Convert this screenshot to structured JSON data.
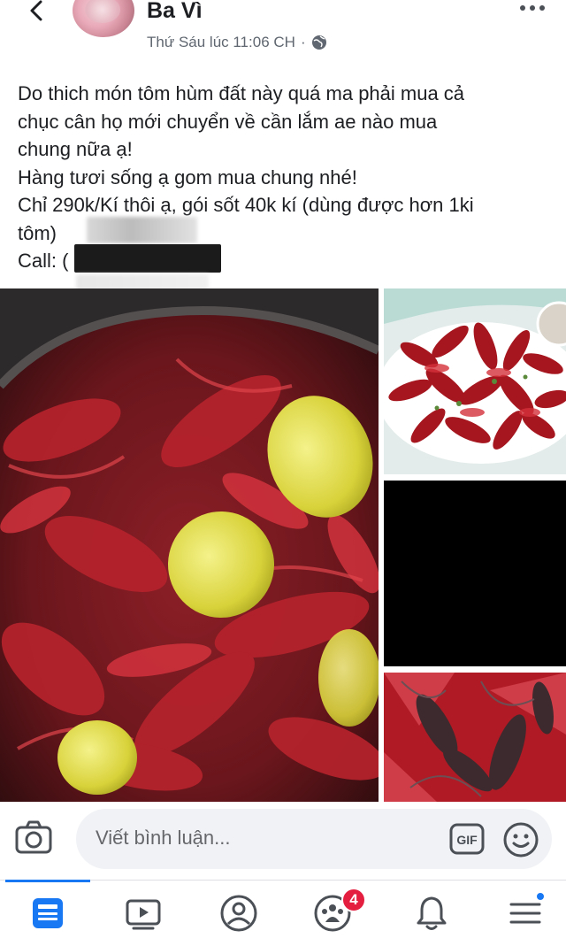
{
  "header": {
    "author_name": "Ba Vì",
    "timestamp": "Thứ Sáu lúc 11:06 CH",
    "separator": "·",
    "privacy_icon": "globe-icon",
    "back_icon": "chevron-left-icon",
    "more_icon": "more-dots-icon"
  },
  "post": {
    "lines": [
      "Do thich món tôm hùm đất này quá ma phải mua cả",
      "chục cân họ mới chuyển về cần lắm ae nào mua",
      "chung nữa ạ!",
      "Hàng tươi sống ạ gom mua chung nhé!",
      "Chỉ 290k/Kí thôi ạ, gói sốt 40k kí (dùng được hơn 1ki",
      "tôm)",
      "Call: ("
    ]
  },
  "photos": {
    "count": 4
  },
  "comment_bar": {
    "placeholder": "Viết bình luận...",
    "gif_label": "GIF",
    "camera_icon": "camera-icon",
    "emoji_icon": "smiley-icon"
  },
  "nav": {
    "items": [
      {
        "icon": "news-feed-icon",
        "active": true
      },
      {
        "icon": "video-icon",
        "active": false
      },
      {
        "icon": "profile-icon",
        "active": false
      },
      {
        "icon": "groups-icon",
        "active": false,
        "badge": "4"
      },
      {
        "icon": "bell-icon",
        "active": false
      },
      {
        "icon": "menu-icon",
        "active": false
      }
    ]
  },
  "colors": {
    "accent": "#1877f2",
    "badge": "#e41e3f",
    "text": "#1c1e21",
    "secondary_text": "#606770"
  }
}
